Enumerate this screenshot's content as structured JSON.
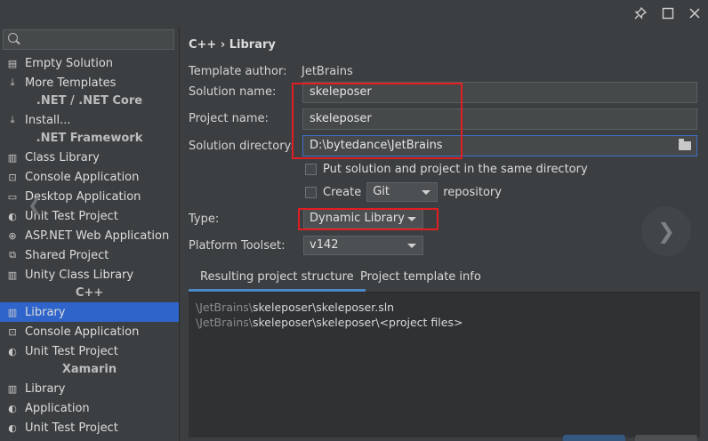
{
  "window": {
    "controls": {
      "pin_icon": "pin-icon",
      "maximize_icon": "maximize-icon",
      "close_icon": "close-icon"
    }
  },
  "sidebar": {
    "search_placeholder": "",
    "items": [
      {
        "type": "item",
        "label": "Empty Solution",
        "icon": "empty-solution-icon",
        "glyph": "▤"
      },
      {
        "type": "item",
        "label": "More Templates",
        "icon": "download-icon",
        "glyph": "⤓"
      },
      {
        "type": "header",
        "label": ".NET / .NET Core"
      },
      {
        "type": "item",
        "label": "Install...",
        "icon": "download-icon",
        "glyph": "⤓"
      },
      {
        "type": "header",
        "label": ".NET Framework"
      },
      {
        "type": "item",
        "label": "Class Library",
        "icon": "library-icon",
        "glyph": "▥"
      },
      {
        "type": "item",
        "label": "Console Application",
        "icon": "console-icon",
        "glyph": "⊡"
      },
      {
        "type": "item",
        "label": "Desktop Application",
        "icon": "desktop-icon",
        "glyph": "▭"
      },
      {
        "type": "item",
        "label": "Unit Test Project",
        "icon": "unit-test-icon",
        "glyph": "◐"
      },
      {
        "type": "item",
        "label": "ASP.NET Web Application",
        "icon": "globe-icon",
        "glyph": "⊕"
      },
      {
        "type": "item",
        "label": "Shared Project",
        "icon": "shared-project-icon",
        "glyph": "⧉"
      },
      {
        "type": "item",
        "label": "Unity Class Library",
        "icon": "unity-library-icon",
        "glyph": "▥"
      },
      {
        "type": "header",
        "label": "C++"
      },
      {
        "type": "item",
        "label": "Library",
        "icon": "library-icon",
        "glyph": "▥",
        "selected": true
      },
      {
        "type": "item",
        "label": "Console Application",
        "icon": "console-icon",
        "glyph": "⊡"
      },
      {
        "type": "item",
        "label": "Unit Test Project",
        "icon": "unit-test-icon",
        "glyph": "◐"
      },
      {
        "type": "header",
        "label": "Xamarin"
      },
      {
        "type": "item",
        "label": "Library",
        "icon": "library-icon",
        "glyph": "▥"
      },
      {
        "type": "item",
        "label": "Application",
        "icon": "application-icon",
        "glyph": "◐"
      },
      {
        "type": "item",
        "label": "Unit Test Project",
        "icon": "unit-test-icon",
        "glyph": "◐"
      }
    ]
  },
  "main": {
    "breadcrumb": "C++ › Library",
    "template_author_label": "Template author:",
    "template_author_value": "JetBrains",
    "solution_name_label": "Solution name:",
    "solution_name_value": "skeleposer",
    "project_name_label": "Project name:",
    "project_name_value": "skeleposer",
    "solution_directory_label": "Solution directory:",
    "solution_directory_value": "D:\\bytedance\\JetBrains",
    "same_directory_label": "Put solution and project in the same directory",
    "create_label": "Create",
    "vcs_value": "Git",
    "repository_label": "repository",
    "type_label": "Type:",
    "type_value": "Dynamic Library",
    "toolset_label": "Platform Toolset:",
    "toolset_value": "v142",
    "tabs": [
      {
        "label": "Resulting project structure",
        "active": true
      },
      {
        "label": "Project template info",
        "active": false
      }
    ],
    "structure": [
      {
        "prefix": "\\JetBrains\\",
        "rest": "skeleposer\\skeleposer.sln"
      },
      {
        "prefix": "\\JetBrains\\",
        "rest": "skeleposer\\skeleposer\\<project files>"
      }
    ]
  },
  "colors": {
    "accent_selected": "#2f65ca",
    "highlight_box": "#e01e22",
    "tab_underline": "#4a88c7"
  }
}
